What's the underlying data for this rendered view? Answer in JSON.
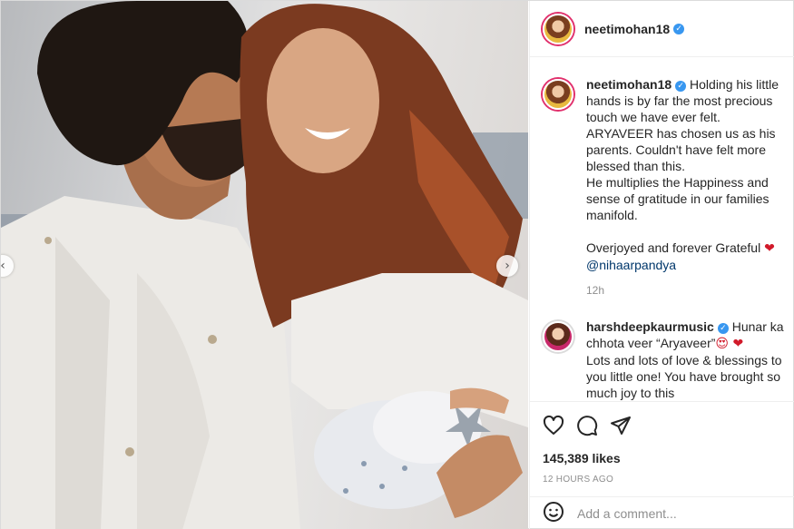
{
  "post": {
    "username": "neetimohan18",
    "caption": "Holding his little hands is by far the most precious touch we have ever felt.\nARYAVEER has chosen us as his parents. Couldn't have felt more blessed than this.\nHe multiplies the Happiness and sense of gratitude in our families manifold.\n\nOverjoyed and forever Grateful",
    "caption_heart": "❤",
    "mention": "@nihaarpandya",
    "caption_time": "12h",
    "likes": "145,389 likes",
    "posted_ago": "12 HOURS AGO"
  },
  "comment": {
    "username": "harshdeepkaurmusic",
    "text_line1": "Hunar ka chhota veer “Aryaveer”",
    "emoji": "😍 ❤",
    "text_rest": "Lots and lots of love & blessings to you little one! You have brought so much joy to this"
  },
  "add_comment": {
    "emoji_icon": "smile-emoji-icon",
    "placeholder": "Add a comment..."
  },
  "nav": {
    "prev": "‹",
    "next": "›"
  },
  "colors": {
    "verified": "#3897f0",
    "heart": "#d11a2a",
    "mention": "#00376b",
    "story_ring": "#e1306c"
  }
}
